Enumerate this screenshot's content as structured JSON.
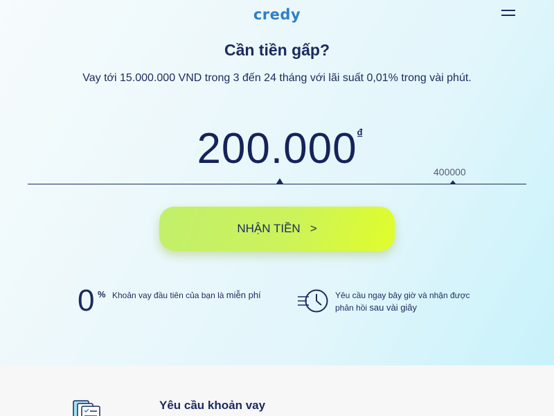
{
  "header": {
    "logo": "credy"
  },
  "hero": {
    "title": "Cần tiền gấp?",
    "subtitle": "Vay tới 15.000.000 VND trong 3 đến 24 tháng với lãi suất 0,01% trong vài phút."
  },
  "loan": {
    "amount_display": "200.000",
    "currency_symbol": "₫",
    "max_label": "400000",
    "amount_value": 200000,
    "slider_max": 400000
  },
  "cta": {
    "label": "NHẬN TIỀN",
    "chevron": ">"
  },
  "features": [
    {
      "big": "0",
      "sup": "%",
      "text": "Khoản vay đầu tiên của bạn là ",
      "highlight": "miễn phí"
    },
    {
      "text": "Yêu cầu ngay bây giờ và nhận được phản hồi ",
      "highlight": "sau vài giây"
    }
  ],
  "section2": {
    "title": "Yêu cầu khoản vay"
  },
  "colors": {
    "primary": "#1b2a5e",
    "logo": "#2f80c8",
    "cta": "#ccf35a"
  },
  "icons": {
    "menu": "hamburger-icon",
    "clock": "fast-clock-icon",
    "document": "document-checklist-icon"
  }
}
